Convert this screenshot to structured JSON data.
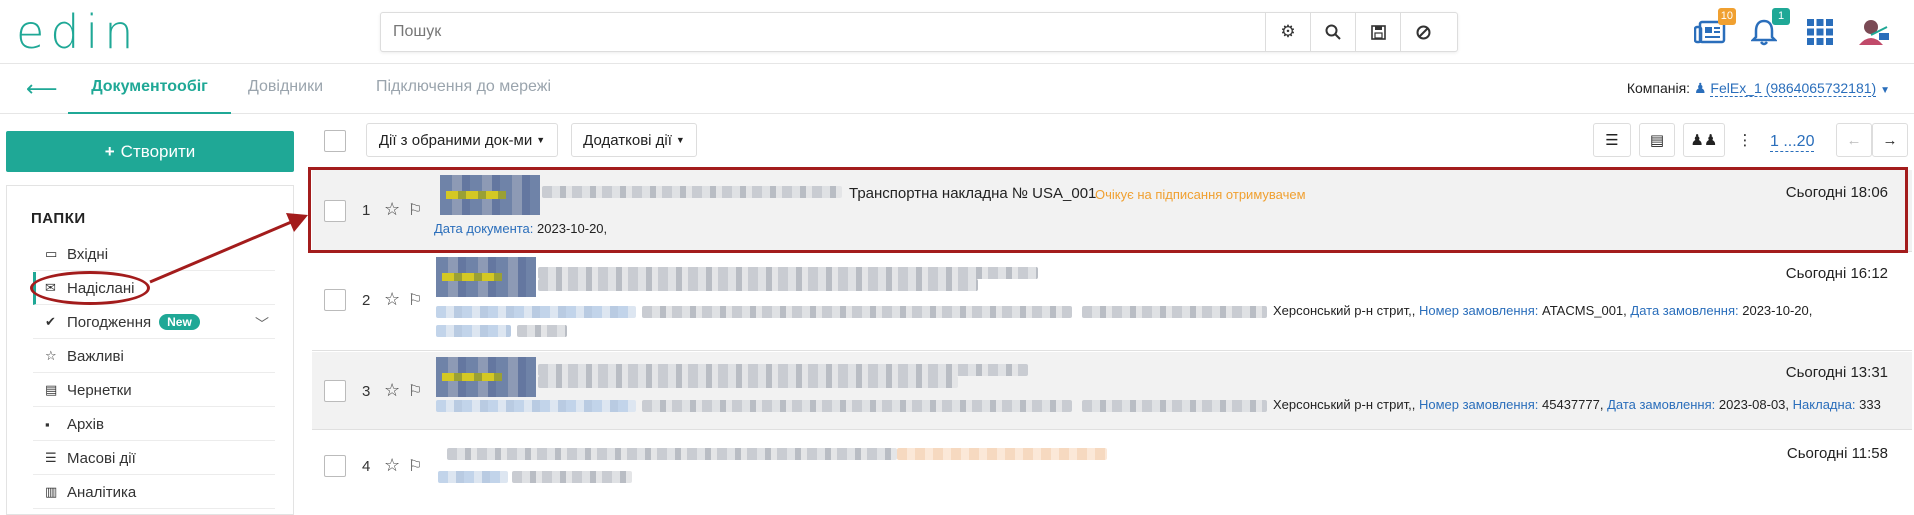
{
  "header": {
    "logo": "edin",
    "search_placeholder": "Пошук",
    "news_badge": "10",
    "notifications_badge": "1"
  },
  "subnav": {
    "tabs": [
      "Документообіг",
      "Довідники",
      "Підключення до мережі"
    ],
    "company_label": "Компанія:",
    "company_value": "FelEx_1 (9864065732181)"
  },
  "sidebar": {
    "create_label": "Створити",
    "folders_title": "ПАПКИ",
    "items": [
      {
        "label": "Вхідні",
        "icon": "inbox-icon"
      },
      {
        "label": "Надіслані",
        "icon": "envelope-icon"
      },
      {
        "label": "Погодження",
        "icon": "check-icon",
        "badge": "New"
      },
      {
        "label": "Важливі",
        "icon": "star-icon"
      },
      {
        "label": "Чернетки",
        "icon": "draft-icon"
      },
      {
        "label": "Архів",
        "icon": "archive-icon"
      },
      {
        "label": "Масові дії",
        "icon": "list-icon"
      },
      {
        "label": "Аналітика",
        "icon": "analytics-icon"
      }
    ]
  },
  "toolbar": {
    "bulk_actions": "Дії з обраними док-ми",
    "more_actions": "Додаткові дії",
    "pager": "1 ...20"
  },
  "rows": [
    {
      "num": "1",
      "time": "Сьогодні 18:06",
      "title": "Транспортна накладна № USA_001",
      "status": "Очікує на підписання отримувачем",
      "doc_date_label": "Дата документа:",
      "doc_date": "2023-10-20,"
    },
    {
      "num": "2",
      "time": "Сьогодні 16:12",
      "addr": "Херсонський р-н стрит,,",
      "order_label": "Номер замовлення:",
      "order": "ATACMS_001,",
      "order_date_label": "Дата замовлення:",
      "order_date": "2023-10-20,"
    },
    {
      "num": "3",
      "time": "Сьогодні 13:31",
      "addr": "Херсонський р-н стрит,,",
      "order_label": "Номер замовлення:",
      "order": "45437777,",
      "order_date_label": "Дата замовлення:",
      "order_date": "2023-08-03,",
      "invoice_label": "Накладна:",
      "invoice": "333"
    },
    {
      "num": "4",
      "time": "Сьогодні 11:58"
    }
  ]
}
